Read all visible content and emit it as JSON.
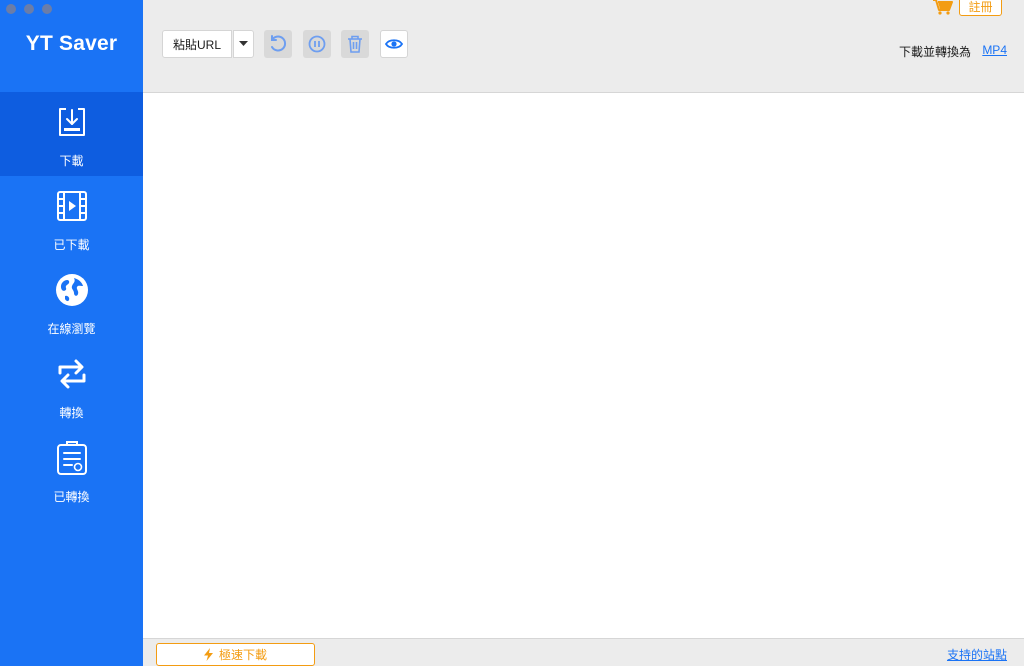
{
  "sidebar": {
    "app_title": "YT Saver",
    "items": [
      {
        "label": "下載",
        "icon": "download-icon",
        "active": true
      },
      {
        "label": "已下載",
        "icon": "film-icon",
        "active": false
      },
      {
        "label": "在線瀏覽",
        "icon": "globe-icon",
        "active": false
      },
      {
        "label": "轉換",
        "icon": "convert-icon",
        "active": false
      },
      {
        "label": "已轉換",
        "icon": "converted-list-icon",
        "active": false
      }
    ]
  },
  "toolbar": {
    "paste_label": "粘貼URL",
    "register_label": "註冊",
    "convert_label": "下載並轉換為",
    "convert_format": "MP4"
  },
  "footer": {
    "turbo_label": "極速下載",
    "sites_label": "支持的站點"
  },
  "colors": {
    "sidebar": "#1a73f5",
    "sidebar_active": "#0e5de0",
    "accent_orange": "#f39c12",
    "link_blue": "#1a73f5",
    "toolbar_bg": "#ececec"
  }
}
